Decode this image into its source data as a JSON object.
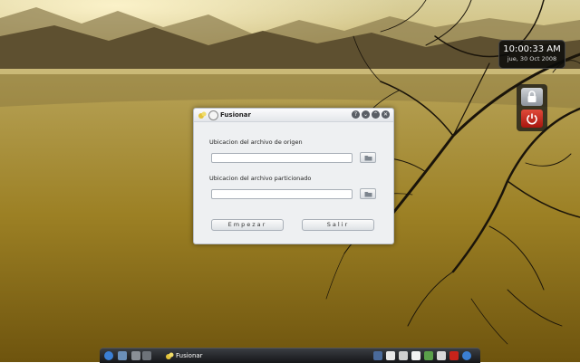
{
  "clock": {
    "time": "10:00:33 AM",
    "date": "jue, 30 Oct 2008"
  },
  "session": {
    "lock_icon": "lock-icon",
    "logout_icon": "power-icon"
  },
  "dialog": {
    "title": "Fusionar",
    "titlebar_buttons": {
      "help": "?",
      "minimize": "⌄",
      "maximize": "⌃",
      "close": "✕"
    },
    "source_label": "Ubicacion del archivo de origen",
    "source_value": "",
    "split_label": "Ubicacion del archivo particionado",
    "split_value": "",
    "start_button": "Empezar",
    "exit_button": "Salir"
  },
  "taskbar": {
    "task_label": "Fusionar",
    "colors": {
      "accent": "#3b7fd4",
      "logout": "#c8231a"
    }
  }
}
